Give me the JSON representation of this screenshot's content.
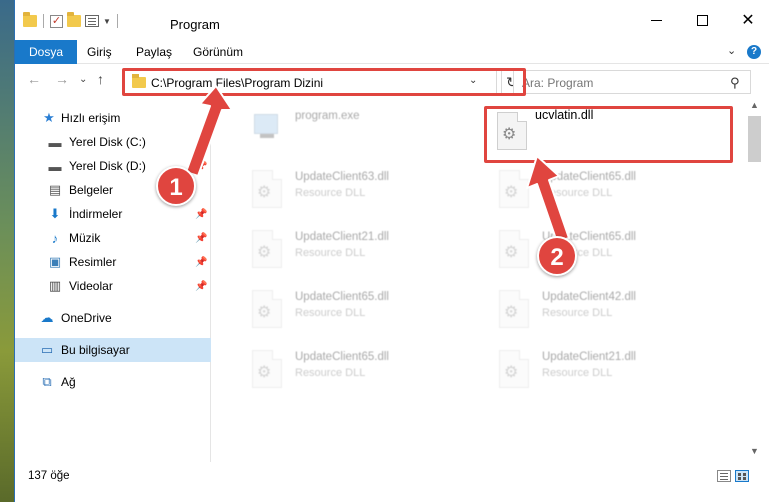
{
  "window": {
    "title": "Program"
  },
  "ribbon": {
    "tabs": [
      "Dosya",
      "Giriş",
      "Paylaş",
      "Görünüm"
    ]
  },
  "address": {
    "path": "C:\\Program Files\\Program Dizini"
  },
  "search": {
    "placeholder": "Ara: Program"
  },
  "sidebar": {
    "items": [
      {
        "label": "Hızlı erişim",
        "icon": "star-icon"
      },
      {
        "label": "Yerel Disk (C:)",
        "icon": "drive-icon"
      },
      {
        "label": "Yerel Disk (D:)",
        "icon": "drive-icon"
      },
      {
        "label": "Belgeler",
        "icon": "document-icon"
      },
      {
        "label": "İndirmeler",
        "icon": "download-icon"
      },
      {
        "label": "Müzik",
        "icon": "music-icon"
      },
      {
        "label": "Resimler",
        "icon": "pictures-icon"
      },
      {
        "label": "Videolar",
        "icon": "video-icon"
      },
      {
        "label": "OneDrive",
        "icon": "cloud-icon"
      },
      {
        "label": "Bu bilgisayar",
        "icon": "computer-icon"
      },
      {
        "label": "Ağ",
        "icon": "network-icon"
      }
    ]
  },
  "files": [
    {
      "name": "program.exe",
      "type": ""
    },
    {
      "name": "ucvlatin.dll",
      "type": ""
    },
    {
      "name": "UpdateClient63.dll",
      "type": "Resource DLL"
    },
    {
      "name": "UpdateClient65.dll",
      "type": "Resource DLL"
    },
    {
      "name": "UpdateClient21.dll",
      "type": "Resource DLL"
    },
    {
      "name": "UpdateClient65.dll",
      "type": "Resource DLL"
    },
    {
      "name": "UpdateClient65.dll",
      "type": "Resource DLL"
    },
    {
      "name": "UpdateClient42.dll",
      "type": "Resource DLL"
    },
    {
      "name": "UpdateClient65.dll",
      "type": "Resource DLL"
    },
    {
      "name": "UpdateClient21.dll",
      "type": "Resource DLL"
    }
  ],
  "status": {
    "count": "137 öğe"
  },
  "callouts": {
    "one": "1",
    "two": "2"
  },
  "colors": {
    "accent": "#1979ca",
    "highlight": "#e0453f",
    "selection": "#cce4f7"
  }
}
